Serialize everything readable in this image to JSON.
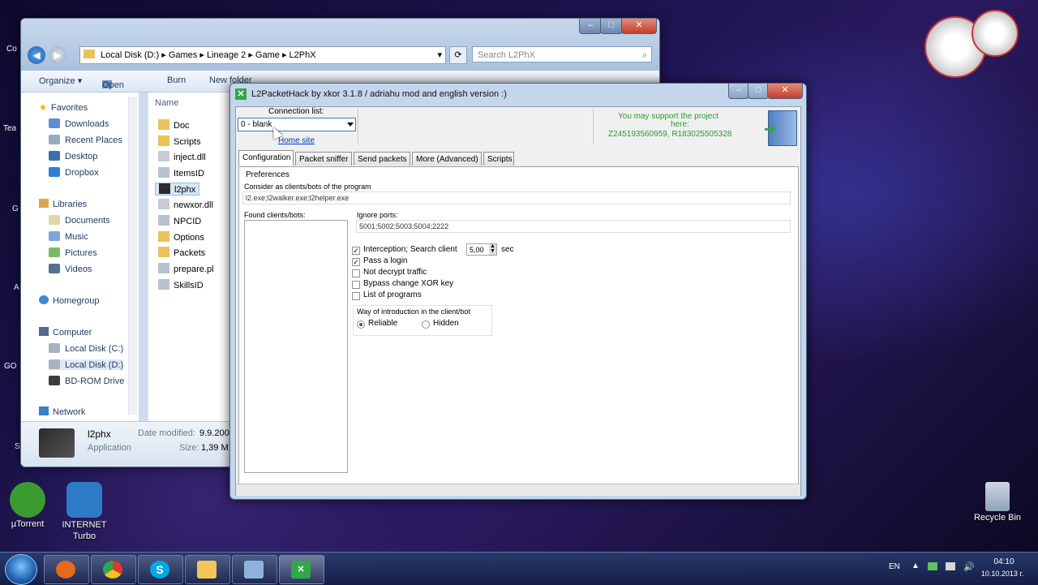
{
  "desktop": {
    "icons": [
      {
        "label": "µTorrent",
        "color": "#3c9b2f"
      },
      {
        "label": "INTERNET Turbo",
        "color": "#2f7ac7"
      },
      {
        "label": "Recycle Bin",
        "color": "#8fa2b8"
      }
    ],
    "left_fragments": [
      "Co",
      "Tea",
      "G",
      "A",
      "GO",
      "S"
    ]
  },
  "explorer": {
    "breadcrumb": [
      "Local Disk (D:)",
      "Games",
      "Lineage 2",
      "Game",
      "L2PhX"
    ],
    "search_placeholder": "Search L2PhX",
    "toolbar": {
      "organize": "Organize ▾",
      "open": "Open",
      "burn": "Burn",
      "new_folder": "New folder"
    },
    "column_name": "Name",
    "nav": {
      "favorites": "Favorites",
      "favorites_items": [
        "Downloads",
        "Recent Places",
        "Desktop",
        "Dropbox"
      ],
      "libraries": "Libraries",
      "libraries_items": [
        "Documents",
        "Music",
        "Pictures",
        "Videos"
      ],
      "homegroup": "Homegroup",
      "computer": "Computer",
      "computer_items": [
        "Local Disk (C:)",
        "Local Disk (D:)",
        "BD-ROM Drive"
      ],
      "network": "Network"
    },
    "files": [
      "Doc",
      "Scripts",
      "inject.dll",
      "ItemsID",
      "l2phx",
      "newxor.dll",
      "NPCID",
      "Options",
      "Packets",
      "prepare.pl",
      "SkillsID"
    ],
    "details": {
      "name": "l2phx",
      "type": "Application",
      "modified_label": "Date modified:",
      "modified_value": "9.9.200",
      "size_label": "Size:",
      "size_value": "1,39 M"
    }
  },
  "l2": {
    "title": "L2PacketHack by xkor 3.1.8 / adriahu mod and english version :)",
    "connection_list_label": "Connection list:",
    "connection_value": "0 - blank",
    "home_site": "Home site",
    "support_line1": "You may support the project",
    "support_line2": "here:",
    "support_line3": "Z245193560959, R183025505328",
    "tabs": [
      "Configuration",
      "Packet sniffer",
      "Send packets",
      "More (Advanced)",
      "Scripts"
    ],
    "preferences": "Preferences",
    "consider_label": "Consider as clients/bots of the program",
    "clients_value": "l2.exe;l2walker.exe;l2helper.exe",
    "found_label": "Found clients/bots:",
    "ignore_ports_label": "Ignore ports:",
    "ignore_ports_value": "5001;5002;5003;5004;2222",
    "checkboxes": [
      {
        "label": "Interception; Search client",
        "checked": true
      },
      {
        "label": "Pass a login",
        "checked": true
      },
      {
        "label": "Not decrypt traffic",
        "checked": false
      },
      {
        "label": "Bypass change XOR key",
        "checked": false
      },
      {
        "label": "List of programs",
        "checked": false
      }
    ],
    "interval_value": "5,00",
    "interval_unit": "sec",
    "way_label": "Way of introduction in the client/bot",
    "radio_reliable": "Reliable",
    "radio_hidden": "Hidden"
  },
  "taskbar": {
    "lang": "EN",
    "time": "04:10",
    "date": "10.10.2013 г.",
    "buttons": [
      {
        "name": "firefox",
        "color": "#e46a1c"
      },
      {
        "name": "chrome",
        "color": "#e2362a"
      },
      {
        "name": "skype",
        "color": "#00a8e8"
      },
      {
        "name": "explorer",
        "color": "#f1c65a"
      },
      {
        "name": "window",
        "color": "#8db3dd"
      },
      {
        "name": "l2phx",
        "color": "#2fa84a"
      }
    ]
  },
  "colors": {
    "accent": "#3c7fb1",
    "support_text": "#2e9a2e",
    "link": "#0033cc"
  }
}
